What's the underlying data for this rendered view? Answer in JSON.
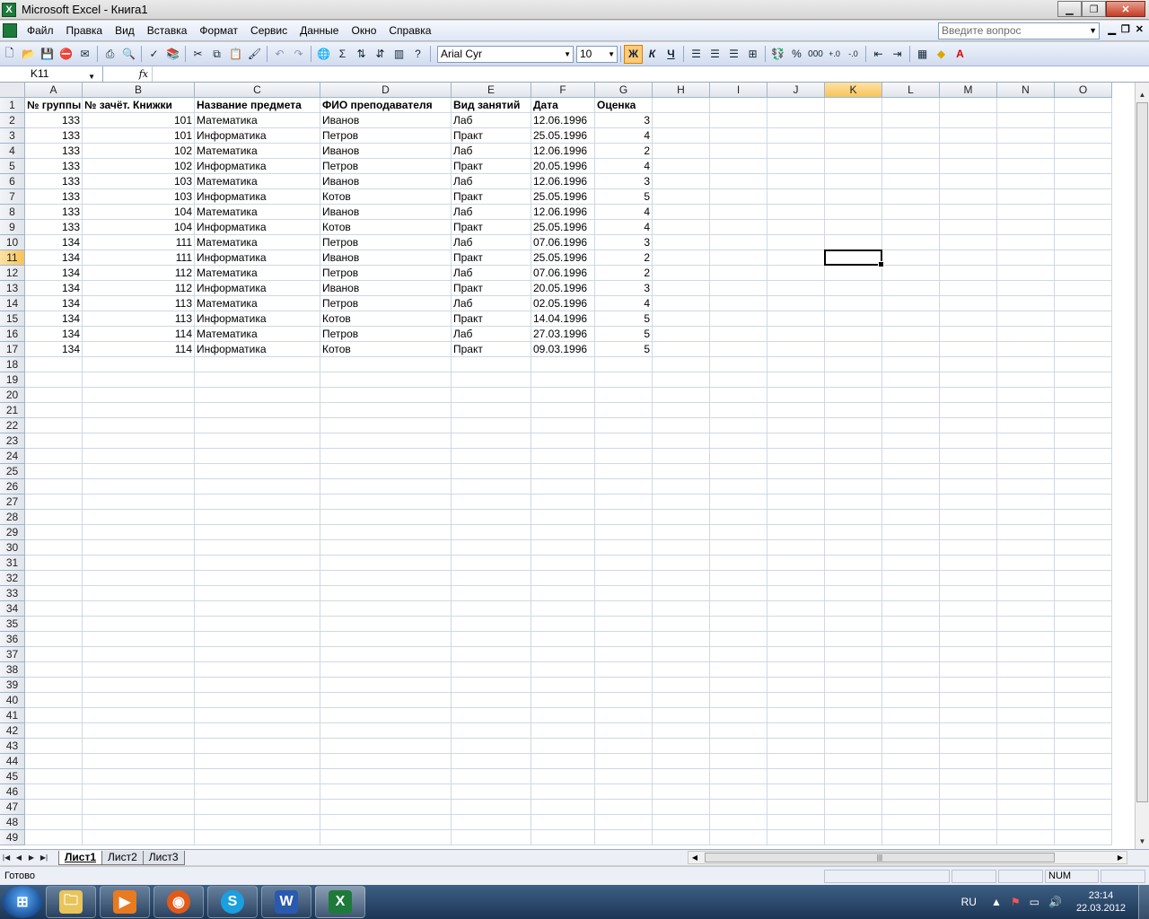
{
  "window": {
    "title": "Microsoft Excel - Книга1"
  },
  "menu": [
    "Файл",
    "Правка",
    "Вид",
    "Вставка",
    "Формат",
    "Сервис",
    "Данные",
    "Окно",
    "Справка"
  ],
  "help_placeholder": "Введите вопрос",
  "toolbar": {
    "font": "Arial Cyr",
    "size": "10",
    "bold": "Ж",
    "italic": "К",
    "underline": "Ч",
    "percent": "%",
    "thousands": "000",
    "sum": "Σ"
  },
  "formula_bar": {
    "name_box": "K11",
    "fx": "fx",
    "content": ""
  },
  "columns": [
    "A",
    "B",
    "C",
    "D",
    "E",
    "F",
    "G",
    "H",
    "I",
    "J",
    "K",
    "L",
    "M",
    "N",
    "O"
  ],
  "selected_column": "K",
  "selected_row": 11,
  "header_row": [
    "№ группы",
    "№ зачёт.  Книжки",
    "Название предмета",
    "ФИО преподавателя",
    "Вид занятий",
    "Дата",
    "Оценка"
  ],
  "data_rows": [
    [
      "133",
      "101",
      "Математика",
      "Иванов",
      "Лаб",
      "12.06.1996",
      "3"
    ],
    [
      "133",
      "101",
      "Информатика",
      "Петров",
      "Практ",
      "25.05.1996",
      "4"
    ],
    [
      "133",
      "102",
      "Математика",
      "Иванов",
      "Лаб",
      "12.06.1996",
      "2"
    ],
    [
      "133",
      "102",
      "Информатика",
      "Петров",
      "Практ",
      "20.05.1996",
      "4"
    ],
    [
      "133",
      "103",
      "Математика",
      "Иванов",
      "Лаб",
      "12.06.1996",
      "3"
    ],
    [
      "133",
      "103",
      "Информатика",
      "Котов",
      "Практ",
      "25.05.1996",
      "5"
    ],
    [
      "133",
      "104",
      "Математика",
      "Иванов",
      "Лаб",
      "12.06.1996",
      "4"
    ],
    [
      "133",
      "104",
      "Информатика",
      "Котов",
      "Практ",
      "25.05.1996",
      "4"
    ],
    [
      "134",
      "111",
      "Математика",
      "Петров",
      "Лаб",
      "07.06.1996",
      "3"
    ],
    [
      "134",
      "111",
      "Информатика",
      "Иванов",
      "Практ",
      "25.05.1996",
      "2"
    ],
    [
      "134",
      "112",
      "Математика",
      "Петров",
      "Лаб",
      "07.06.1996",
      "2"
    ],
    [
      "134",
      "112",
      "Информатика",
      "Иванов",
      "Практ",
      "20.05.1996",
      "3"
    ],
    [
      "134",
      "113",
      "Математика",
      "Петров",
      "Лаб",
      "02.05.1996",
      "4"
    ],
    [
      "134",
      "113",
      "Информатика",
      "Котов",
      "Практ",
      "14.04.1996",
      "5"
    ],
    [
      "134",
      "114",
      "Математика",
      "Петров",
      "Лаб",
      "27.03.1996",
      "5"
    ],
    [
      "134",
      "114",
      "Информатика",
      "Котов",
      "Практ",
      "09.03.1996",
      "5"
    ]
  ],
  "total_rows": 49,
  "sheets": [
    "Лист1",
    "Лист2",
    "Лист3"
  ],
  "active_sheet": "Лист1",
  "status": {
    "text": "Готово",
    "num": "NUM"
  },
  "taskbar": {
    "apps": [
      "explorer-icon",
      "media-player-icon",
      "firefox-icon",
      "skype-icon",
      "word-icon",
      "excel-icon"
    ],
    "lang": "RU",
    "time": "23:14",
    "date": "22.03.2012"
  },
  "colors": {
    "accent": "#f7c35a",
    "grid": "#d0d7e5",
    "excel_green": "#1d7a3a"
  }
}
